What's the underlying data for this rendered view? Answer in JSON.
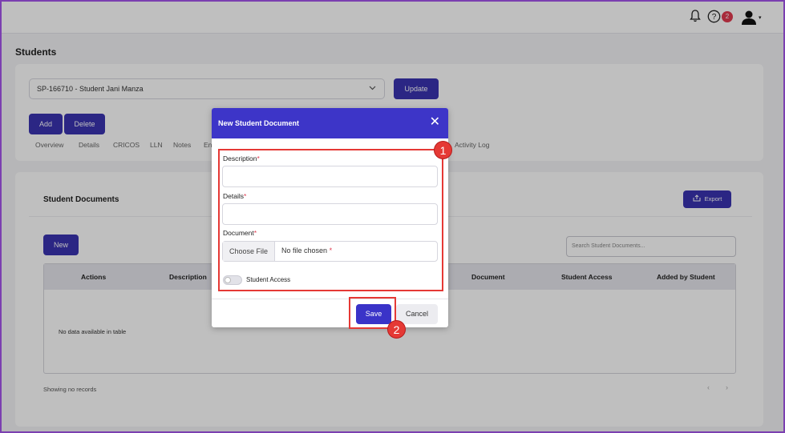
{
  "topbar": {
    "notifications_icon": "bell-icon",
    "help_icon": "question-circle-icon",
    "help_badge": "2",
    "user_icon": "user-icon",
    "caret": "▾"
  },
  "page": {
    "title": "Students"
  },
  "student": {
    "selected": "SP-166710 - Student Jani Manza",
    "update_label": "Update",
    "add_label": "Add",
    "delete_label": "Delete"
  },
  "tabs": [
    "Overview",
    "Details",
    "CRICOS",
    "LLN",
    "Notes",
    "En",
    "Activity Log"
  ],
  "documents": {
    "title": "Student Documents",
    "export_label": "Export",
    "new_label": "New",
    "search_placeholder": "Search Student Documents...",
    "columns": [
      "Actions",
      "Description",
      "Document",
      "Student Access",
      "Added by Student"
    ],
    "empty_text": "No data available in table",
    "footer_text": "Showing no records",
    "pager_prev": "‹",
    "pager_next": "›"
  },
  "modal": {
    "title": "New Student Document",
    "close": "✕",
    "description_label": "Description",
    "details_label": "Details",
    "document_label": "Document",
    "required_mark": "*",
    "choose_file": "Choose File",
    "no_file": "No file chosen",
    "student_access_label": "Student Access",
    "student_access_on": false,
    "save_label": "Save",
    "cancel_label": "Cancel"
  },
  "annotations": {
    "step1": "1",
    "step2": "2"
  },
  "colors": {
    "primary": "#3a33b0",
    "modal_header": "#3d35c8",
    "highlight": "#e53935",
    "badge": "#e03a4f"
  }
}
